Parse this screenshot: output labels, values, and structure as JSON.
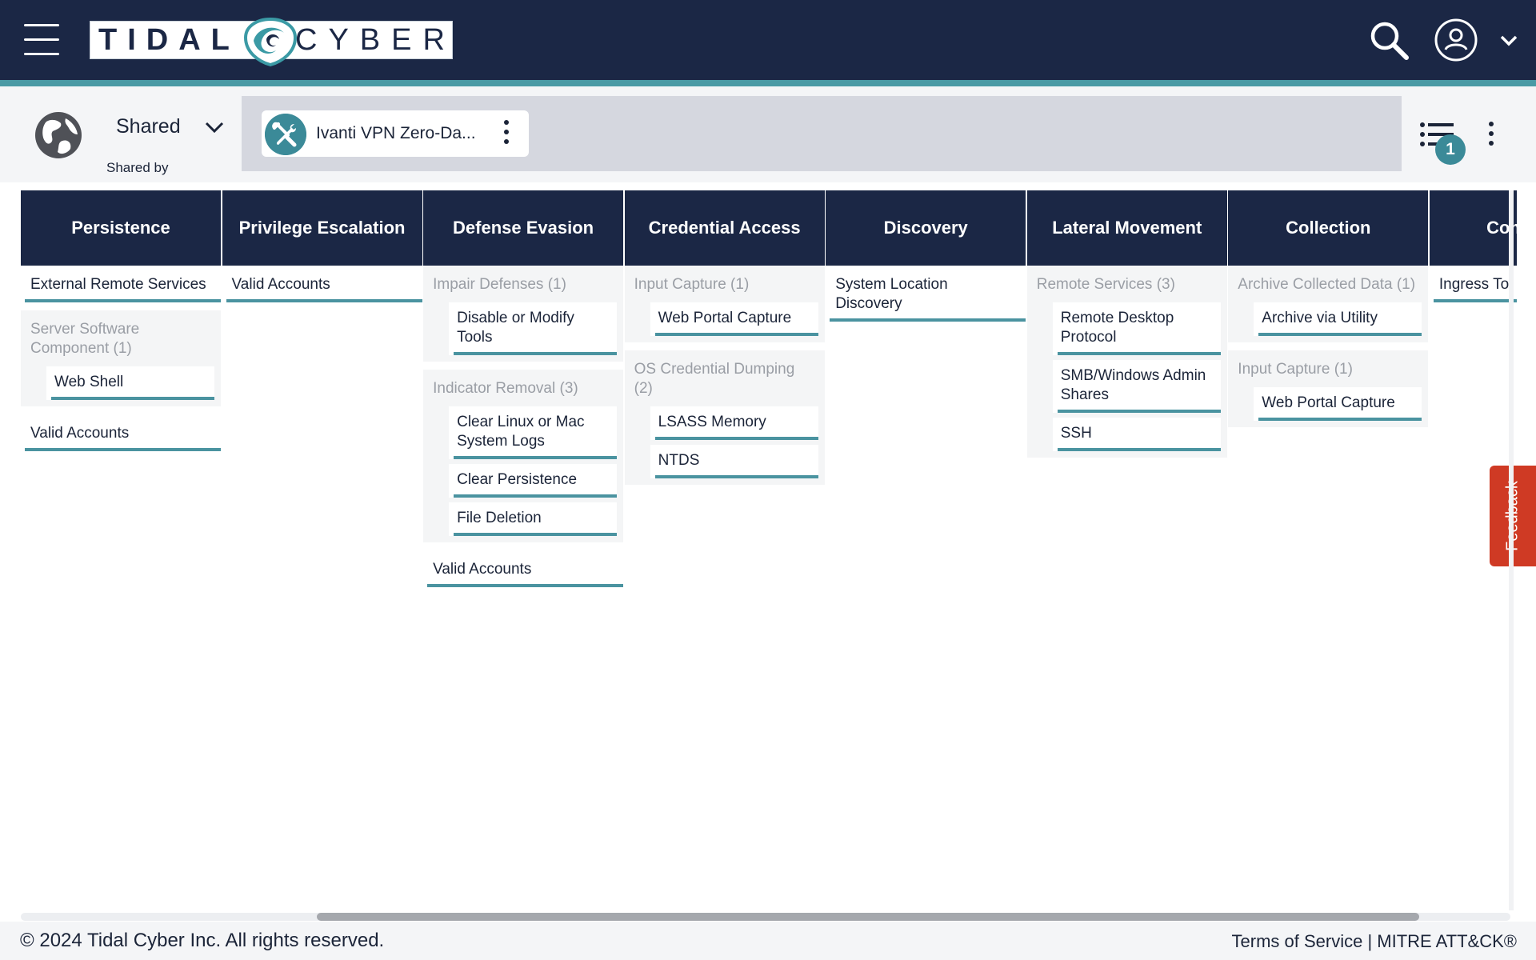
{
  "header": {
    "logo_left": "TIDAL",
    "logo_right": "CYBER"
  },
  "subheader": {
    "scope_label": "Shared",
    "shared_by_label": "Shared by",
    "tab_label": "Ivanti VPN Zero-Da...",
    "filter_count": "1"
  },
  "matrix": {
    "tactics": [
      {
        "name": "Persistence",
        "items": [
          {
            "type": "technique",
            "label": "External Remote Services"
          },
          {
            "type": "group",
            "label": "Server Software Component (1)",
            "subs": [
              "Web Shell"
            ]
          },
          {
            "type": "technique",
            "label": "Valid Accounts"
          }
        ]
      },
      {
        "name": "Privilege Escalation",
        "items": [
          {
            "type": "technique",
            "label": "Valid Accounts"
          }
        ]
      },
      {
        "name": "Defense Evasion",
        "items": [
          {
            "type": "group",
            "label": "Impair Defenses (1)",
            "subs": [
              "Disable or Modify Tools"
            ]
          },
          {
            "type": "group",
            "label": "Indicator Removal (3)",
            "subs": [
              "Clear Linux or Mac System Logs",
              "Clear Persistence",
              "File Deletion"
            ]
          },
          {
            "type": "technique",
            "label": "Valid Accounts"
          }
        ]
      },
      {
        "name": "Credential Access",
        "items": [
          {
            "type": "group",
            "label": "Input Capture (1)",
            "subs": [
              "Web Portal Capture"
            ]
          },
          {
            "type": "group",
            "label": "OS Credential Dumping (2)",
            "subs": [
              "LSASS Memory",
              "NTDS"
            ]
          }
        ]
      },
      {
        "name": "Discovery",
        "items": [
          {
            "type": "technique",
            "label": "System Location Discovery"
          }
        ]
      },
      {
        "name": "Lateral Movement",
        "items": [
          {
            "type": "group",
            "label": "Remote Services (3)",
            "subs": [
              "Remote Desktop Protocol",
              "SMB/Windows Admin Shares",
              "SSH"
            ]
          }
        ]
      },
      {
        "name": "Collection",
        "items": [
          {
            "type": "group",
            "label": "Archive Collected Data (1)",
            "subs": [
              "Archive via Utility"
            ]
          },
          {
            "type": "group",
            "label": "Input Capture (1)",
            "subs": [
              "Web Portal Capture"
            ]
          }
        ]
      },
      {
        "name": "Command",
        "items": [
          {
            "type": "technique",
            "label": "Ingress To"
          }
        ]
      }
    ]
  },
  "feedback_label": "Feedback",
  "footer": {
    "copyright": "© 2024 Tidal Cyber Inc. All rights reserved.",
    "terms": "Terms of Service",
    "separator": " | ",
    "mitre": "MITRE ATT&CK®"
  },
  "colors": {
    "navy": "#1b2745",
    "teal": "#4a9aa5",
    "feedback_red": "#cf3a24"
  }
}
